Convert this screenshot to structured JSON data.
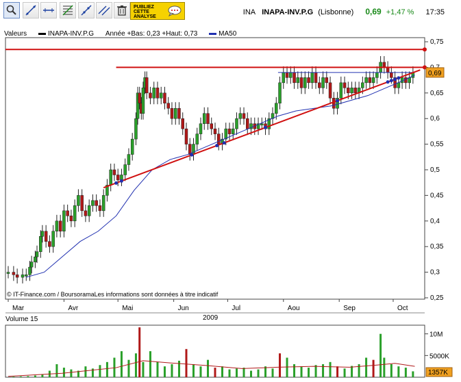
{
  "toolbar": {
    "buttons": [
      {
        "name": "zoom-icon",
        "active": true
      },
      {
        "name": "draw-line-icon"
      },
      {
        "name": "horizontal-line-icon"
      },
      {
        "name": "fibonacci-icon"
      },
      {
        "name": "trend-points-icon"
      },
      {
        "name": "parallel-lines-icon"
      },
      {
        "name": "trash-icon"
      }
    ],
    "ad_line1": "PUBLIEZ",
    "ad_line2": "CETTE",
    "ad_line3": "ANALYSE"
  },
  "ticker": {
    "symbol": "INA",
    "name": "INAPA-INV.P.G",
    "exchange": "(Lisbonne)",
    "price": "0,69",
    "change": "+1,47 %",
    "time": "17:35",
    "up_color": "#1a8a1a"
  },
  "legend": {
    "valeurs": "Valeurs",
    "series_name": "INAPA-INV.P.G",
    "range_text": "Année +Bas: 0,23 +Haut: 0,73",
    "ma_name": "MA50",
    "ma_color": "#2030b0"
  },
  "footer": {
    "credit": "© IT-Finance.com / BoursoramaLes informations sont données à titre indicatif",
    "year": "2009"
  },
  "volume": {
    "label": "Volume 15",
    "current_badge": "1357K"
  },
  "chart_data": [
    {
      "type": "candlestick",
      "ylim": [
        0.25,
        0.75
      ],
      "y_ticks": [
        "0,25",
        "0,3",
        "0,35",
        "0,4",
        "0,45",
        "0,5",
        "0,55",
        "0,6",
        "0,65",
        "0,7",
        "0,75"
      ],
      "months": [
        "Mar",
        "Avr",
        "Mai",
        "Jun",
        "Jul",
        "Aou",
        "Sep",
        "Oct"
      ],
      "last_price_label": "0,69",
      "close_series": [
        {
          "d": 0,
          "v": 0.3
        },
        {
          "d": 3,
          "v": 0.295
        },
        {
          "d": 5,
          "v": 0.29
        },
        {
          "d": 8,
          "v": 0.295
        },
        {
          "d": 10,
          "v": 0.295
        },
        {
          "d": 12,
          "v": 0.31
        },
        {
          "d": 13,
          "v": 0.32
        },
        {
          "d": 15,
          "v": 0.33
        },
        {
          "d": 16,
          "v": 0.34
        },
        {
          "d": 18,
          "v": 0.37
        },
        {
          "d": 19,
          "v": 0.38
        },
        {
          "d": 21,
          "v": 0.36
        },
        {
          "d": 23,
          "v": 0.35
        },
        {
          "d": 25,
          "v": 0.38
        },
        {
          "d": 27,
          "v": 0.4
        },
        {
          "d": 29,
          "v": 0.38
        },
        {
          "d": 31,
          "v": 0.42
        },
        {
          "d": 33,
          "v": 0.41
        },
        {
          "d": 35,
          "v": 0.4
        },
        {
          "d": 37,
          "v": 0.43
        },
        {
          "d": 39,
          "v": 0.45
        },
        {
          "d": 41,
          "v": 0.42
        },
        {
          "d": 43,
          "v": 0.41
        },
        {
          "d": 45,
          "v": 0.43
        },
        {
          "d": 47,
          "v": 0.44
        },
        {
          "d": 49,
          "v": 0.43
        },
        {
          "d": 51,
          "v": 0.42
        },
        {
          "d": 53,
          "v": 0.45
        },
        {
          "d": 55,
          "v": 0.47
        },
        {
          "d": 57,
          "v": 0.5
        },
        {
          "d": 59,
          "v": 0.49
        },
        {
          "d": 61,
          "v": 0.48
        },
        {
          "d": 63,
          "v": 0.49
        },
        {
          "d": 65,
          "v": 0.51
        },
        {
          "d": 67,
          "v": 0.53
        },
        {
          "d": 69,
          "v": 0.56
        },
        {
          "d": 71,
          "v": 0.6
        },
        {
          "d": 72,
          "v": 0.65
        },
        {
          "d": 73,
          "v": 0.63
        },
        {
          "d": 74,
          "v": 0.61
        },
        {
          "d": 75,
          "v": 0.66
        },
        {
          "d": 76,
          "v": 0.68
        },
        {
          "d": 77,
          "v": 0.65
        },
        {
          "d": 79,
          "v": 0.64
        },
        {
          "d": 81,
          "v": 0.66
        },
        {
          "d": 83,
          "v": 0.64
        },
        {
          "d": 85,
          "v": 0.65
        },
        {
          "d": 87,
          "v": 0.63
        },
        {
          "d": 89,
          "v": 0.62
        },
        {
          "d": 91,
          "v": 0.6
        },
        {
          "d": 93,
          "v": 0.62
        },
        {
          "d": 95,
          "v": 0.6
        },
        {
          "d": 97,
          "v": 0.58
        },
        {
          "d": 99,
          "v": 0.55
        },
        {
          "d": 101,
          "v": 0.53
        },
        {
          "d": 103,
          "v": 0.55
        },
        {
          "d": 105,
          "v": 0.57
        },
        {
          "d": 107,
          "v": 0.59
        },
        {
          "d": 109,
          "v": 0.61
        },
        {
          "d": 111,
          "v": 0.59
        },
        {
          "d": 113,
          "v": 0.58
        },
        {
          "d": 115,
          "v": 0.57
        },
        {
          "d": 117,
          "v": 0.55
        },
        {
          "d": 119,
          "v": 0.56
        },
        {
          "d": 121,
          "v": 0.58
        },
        {
          "d": 123,
          "v": 0.57
        },
        {
          "d": 125,
          "v": 0.58
        },
        {
          "d": 127,
          "v": 0.6
        },
        {
          "d": 129,
          "v": 0.61
        },
        {
          "d": 131,
          "v": 0.6
        },
        {
          "d": 133,
          "v": 0.58
        },
        {
          "d": 135,
          "v": 0.59
        },
        {
          "d": 137,
          "v": 0.58
        },
        {
          "d": 139,
          "v": 0.59
        },
        {
          "d": 141,
          "v": 0.59
        },
        {
          "d": 143,
          "v": 0.58
        },
        {
          "d": 145,
          "v": 0.6
        },
        {
          "d": 147,
          "v": 0.61
        },
        {
          "d": 149,
          "v": 0.63
        },
        {
          "d": 151,
          "v": 0.67
        },
        {
          "d": 153,
          "v": 0.69
        },
        {
          "d": 155,
          "v": 0.68
        },
        {
          "d": 157,
          "v": 0.69
        },
        {
          "d": 159,
          "v": 0.67
        },
        {
          "d": 161,
          "v": 0.68
        },
        {
          "d": 163,
          "v": 0.66
        },
        {
          "d": 165,
          "v": 0.68
        },
        {
          "d": 167,
          "v": 0.67
        },
        {
          "d": 169,
          "v": 0.69
        },
        {
          "d": 171,
          "v": 0.67
        },
        {
          "d": 173,
          "v": 0.66
        },
        {
          "d": 175,
          "v": 0.68
        },
        {
          "d": 177,
          "v": 0.67
        },
        {
          "d": 179,
          "v": 0.64
        },
        {
          "d": 181,
          "v": 0.62
        },
        {
          "d": 183,
          "v": 0.64
        },
        {
          "d": 185,
          "v": 0.67
        },
        {
          "d": 187,
          "v": 0.66
        },
        {
          "d": 189,
          "v": 0.65
        },
        {
          "d": 191,
          "v": 0.66
        },
        {
          "d": 193,
          "v": 0.65
        },
        {
          "d": 195,
          "v": 0.66
        },
        {
          "d": 197,
          "v": 0.67
        },
        {
          "d": 199,
          "v": 0.68
        },
        {
          "d": 201,
          "v": 0.67
        },
        {
          "d": 203,
          "v": 0.68
        },
        {
          "d": 205,
          "v": 0.69
        },
        {
          "d": 207,
          "v": 0.71
        },
        {
          "d": 209,
          "v": 0.7
        },
        {
          "d": 211,
          "v": 0.69
        },
        {
          "d": 213,
          "v": 0.68
        },
        {
          "d": 215,
          "v": 0.66
        },
        {
          "d": 217,
          "v": 0.67
        },
        {
          "d": 219,
          "v": 0.68
        },
        {
          "d": 221,
          "v": 0.67
        },
        {
          "d": 223,
          "v": 0.68
        },
        {
          "d": 225,
          "v": 0.69
        }
      ],
      "ma50": [
        {
          "d": 10,
          "v": 0.29
        },
        {
          "d": 20,
          "v": 0.3
        },
        {
          "d": 30,
          "v": 0.33
        },
        {
          "d": 40,
          "v": 0.36
        },
        {
          "d": 50,
          "v": 0.38
        },
        {
          "d": 60,
          "v": 0.41
        },
        {
          "d": 70,
          "v": 0.46
        },
        {
          "d": 80,
          "v": 0.5
        },
        {
          "d": 90,
          "v": 0.52
        },
        {
          "d": 100,
          "v": 0.53
        },
        {
          "d": 110,
          "v": 0.545
        },
        {
          "d": 120,
          "v": 0.56
        },
        {
          "d": 130,
          "v": 0.575
        },
        {
          "d": 140,
          "v": 0.59
        },
        {
          "d": 150,
          "v": 0.605
        },
        {
          "d": 160,
          "v": 0.615
        },
        {
          "d": 170,
          "v": 0.62
        },
        {
          "d": 180,
          "v": 0.625
        },
        {
          "d": 190,
          "v": 0.635
        },
        {
          "d": 200,
          "v": 0.645
        },
        {
          "d": 210,
          "v": 0.66
        },
        {
          "d": 220,
          "v": 0.675
        },
        {
          "d": 226,
          "v": 0.685
        }
      ],
      "lines": [
        {
          "type": "resistance",
          "value": 0.735,
          "color": "#d01010"
        },
        {
          "type": "resistance",
          "value": 0.7,
          "color": "#d01010"
        },
        {
          "type": "support",
          "value": 0.69,
          "color": "#2030b0"
        },
        {
          "type": "uptrend",
          "from": {
            "d": 53,
            "v": 0.465
          },
          "to": {
            "d": 229,
            "v": 0.695
          },
          "color": "#d01010"
        }
      ]
    },
    {
      "type": "bar",
      "title": "Volume 15",
      "y_ticks": [
        "5000K",
        "10M"
      ],
      "ylim": [
        0,
        12000
      ],
      "units": "K",
      "volumes": [
        {
          "d": 3,
          "v": 150
        },
        {
          "d": 7,
          "v": 200
        },
        {
          "d": 11,
          "v": 250
        },
        {
          "d": 15,
          "v": 400
        },
        {
          "d": 19,
          "v": 600
        },
        {
          "d": 23,
          "v": 1500
        },
        {
          "d": 27,
          "v": 3000
        },
        {
          "d": 31,
          "v": 2200
        },
        {
          "d": 35,
          "v": 1800
        },
        {
          "d": 39,
          "v": 1500
        },
        {
          "d": 43,
          "v": 2500
        },
        {
          "d": 47,
          "v": 2000
        },
        {
          "d": 51,
          "v": 2800
        },
        {
          "d": 55,
          "v": 3500
        },
        {
          "d": 59,
          "v": 4500
        },
        {
          "d": 63,
          "v": 6000
        },
        {
          "d": 67,
          "v": 4000
        },
        {
          "d": 71,
          "v": 5500
        },
        {
          "d": 73,
          "v": 11500
        },
        {
          "d": 75,
          "v": 3500
        },
        {
          "d": 79,
          "v": 6000
        },
        {
          "d": 83,
          "v": 3500
        },
        {
          "d": 87,
          "v": 2500
        },
        {
          "d": 91,
          "v": 3000
        },
        {
          "d": 95,
          "v": 3800
        },
        {
          "d": 99,
          "v": 6500
        },
        {
          "d": 103,
          "v": 3000
        },
        {
          "d": 107,
          "v": 2500
        },
        {
          "d": 111,
          "v": 4000
        },
        {
          "d": 115,
          "v": 2200
        },
        {
          "d": 119,
          "v": 2500
        },
        {
          "d": 123,
          "v": 1800
        },
        {
          "d": 127,
          "v": 2000
        },
        {
          "d": 131,
          "v": 2200
        },
        {
          "d": 135,
          "v": 1500
        },
        {
          "d": 139,
          "v": 1800
        },
        {
          "d": 143,
          "v": 2500
        },
        {
          "d": 147,
          "v": 2000
        },
        {
          "d": 151,
          "v": 5500
        },
        {
          "d": 155,
          "v": 4500
        },
        {
          "d": 159,
          "v": 3000
        },
        {
          "d": 163,
          "v": 2500
        },
        {
          "d": 167,
          "v": 2200
        },
        {
          "d": 171,
          "v": 2800
        },
        {
          "d": 175,
          "v": 3000
        },
        {
          "d": 179,
          "v": 3500
        },
        {
          "d": 183,
          "v": 2500
        },
        {
          "d": 187,
          "v": 2000
        },
        {
          "d": 191,
          "v": 2600
        },
        {
          "d": 195,
          "v": 3000
        },
        {
          "d": 199,
          "v": 4500
        },
        {
          "d": 203,
          "v": 4000
        },
        {
          "d": 207,
          "v": 10000
        },
        {
          "d": 209,
          "v": 4500
        },
        {
          "d": 213,
          "v": 3000
        },
        {
          "d": 217,
          "v": 2500
        },
        {
          "d": 221,
          "v": 2200
        },
        {
          "d": 225,
          "v": 1357
        }
      ],
      "avg": [
        {
          "d": 0,
          "v": 200
        },
        {
          "d": 30,
          "v": 900
        },
        {
          "d": 60,
          "v": 2200
        },
        {
          "d": 75,
          "v": 3800
        },
        {
          "d": 90,
          "v": 3300
        },
        {
          "d": 110,
          "v": 2700
        },
        {
          "d": 130,
          "v": 2000
        },
        {
          "d": 150,
          "v": 2300
        },
        {
          "d": 170,
          "v": 2500
        },
        {
          "d": 190,
          "v": 2300
        },
        {
          "d": 205,
          "v": 2800
        },
        {
          "d": 215,
          "v": 3200
        },
        {
          "d": 226,
          "v": 2500
        }
      ]
    }
  ]
}
